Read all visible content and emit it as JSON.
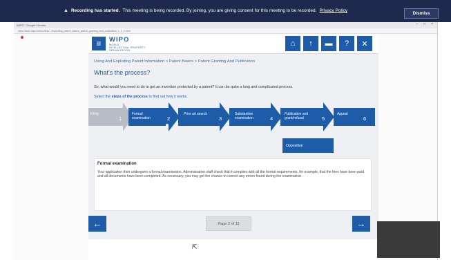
{
  "banner": {
    "warning_icon": "warning-triangle-icon",
    "strong": "Recording has started.",
    "message": "This meeting is being recorded. By joining, you are giving consent for this meeting to be recorded.",
    "link": "Privacy Policy",
    "dismiss": "Dismiss"
  },
  "browser": {
    "title": "WIPO - Google Chrome",
    "url": "https://welc.wipo.int/acc/lms/.../exploiting_patent_basics_patent_granting_and_publication_1_2_2.html",
    "controls": [
      "–",
      "□",
      "×"
    ]
  },
  "module": {
    "logo": {
      "name": "WIPO",
      "sub1": "WORLD",
      "sub2": "INTELLECTUAL PROPERTY",
      "sub3": "ORGANIZATION"
    },
    "toolbar_icons": [
      "home-icon",
      "up-arrow-icon",
      "folder-icon",
      "help-icon",
      "close-icon"
    ],
    "toolbar_glyphs": [
      "⌂",
      "↑",
      "▬",
      "?",
      "✕"
    ],
    "breadcrumb": "Using And Exploiting Patent Information > Patent Basics > Patent Granting And Publication",
    "title": "What's the process?",
    "intro": "So, what would you need to do to get an invention protected by a patent? It can be quite a long and complicated process.",
    "instruction_pre": "Select the ",
    "instruction_bold": "steps of the process",
    "instruction_post": " to find out how it works.",
    "steps": [
      {
        "label": "Filing",
        "num": "1",
        "state": "inactive"
      },
      {
        "label": "Formal examination",
        "num": "2",
        "state": "selected"
      },
      {
        "label": "Prior art search",
        "num": "3",
        "state": "active"
      },
      {
        "label": "Substantive examination",
        "num": "4",
        "state": "active"
      },
      {
        "label": "Publication and grant/refusal",
        "num": "5",
        "state": "active"
      },
      {
        "label": "Appeal",
        "num": "6",
        "state": "active"
      }
    ],
    "opposition": "Opposition",
    "description": {
      "heading": "Formal examination",
      "text": "Your application then undergoes a formal examination. Administrative staff check that it complies with all the formal requirements, for example, that the fees have been paid and all documents have been completed. As necessary, you may get the chance to correct any errors found during the examination."
    },
    "nav": {
      "prev_icon": "left-arrow-icon",
      "next_icon": "right-arrow-icon",
      "page": "Page 2 of 11"
    },
    "colors": {
      "primary": "#1f5ca8",
      "inactive": "#b8bcc4",
      "banner": "#1e2a4d"
    }
  }
}
